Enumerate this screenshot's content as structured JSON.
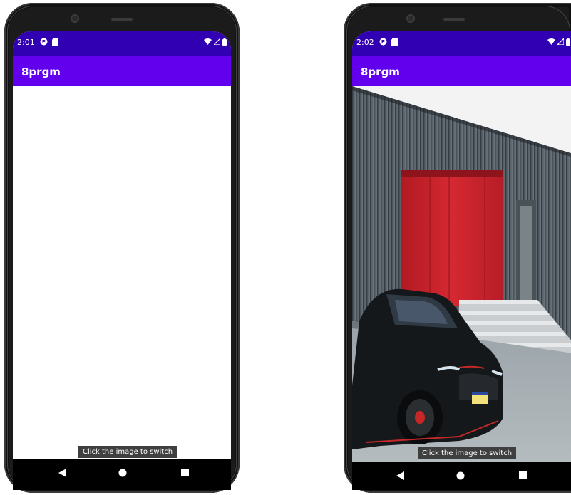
{
  "phones": [
    {
      "status": {
        "time": "2:01"
      },
      "app_bar": {
        "title": "8prgm"
      },
      "toast": {
        "text": "Click the image to switch"
      }
    },
    {
      "status": {
        "time": "2:02"
      },
      "app_bar": {
        "title": "8prgm"
      },
      "toast": {
        "text": "Click the image to switch"
      }
    }
  ],
  "colors": {
    "status_bar": "#3200b3",
    "app_bar": "#6200ee",
    "nav_bar": "#000000",
    "toast_bg": "#3f3f3f"
  },
  "icons": {
    "status_left": [
      "notification-p-icon",
      "sd-card-icon"
    ],
    "status_right": [
      "wifi-icon",
      "signal-icon",
      "battery-icon"
    ],
    "nav": [
      "back-icon",
      "home-icon",
      "recents-icon"
    ]
  }
}
